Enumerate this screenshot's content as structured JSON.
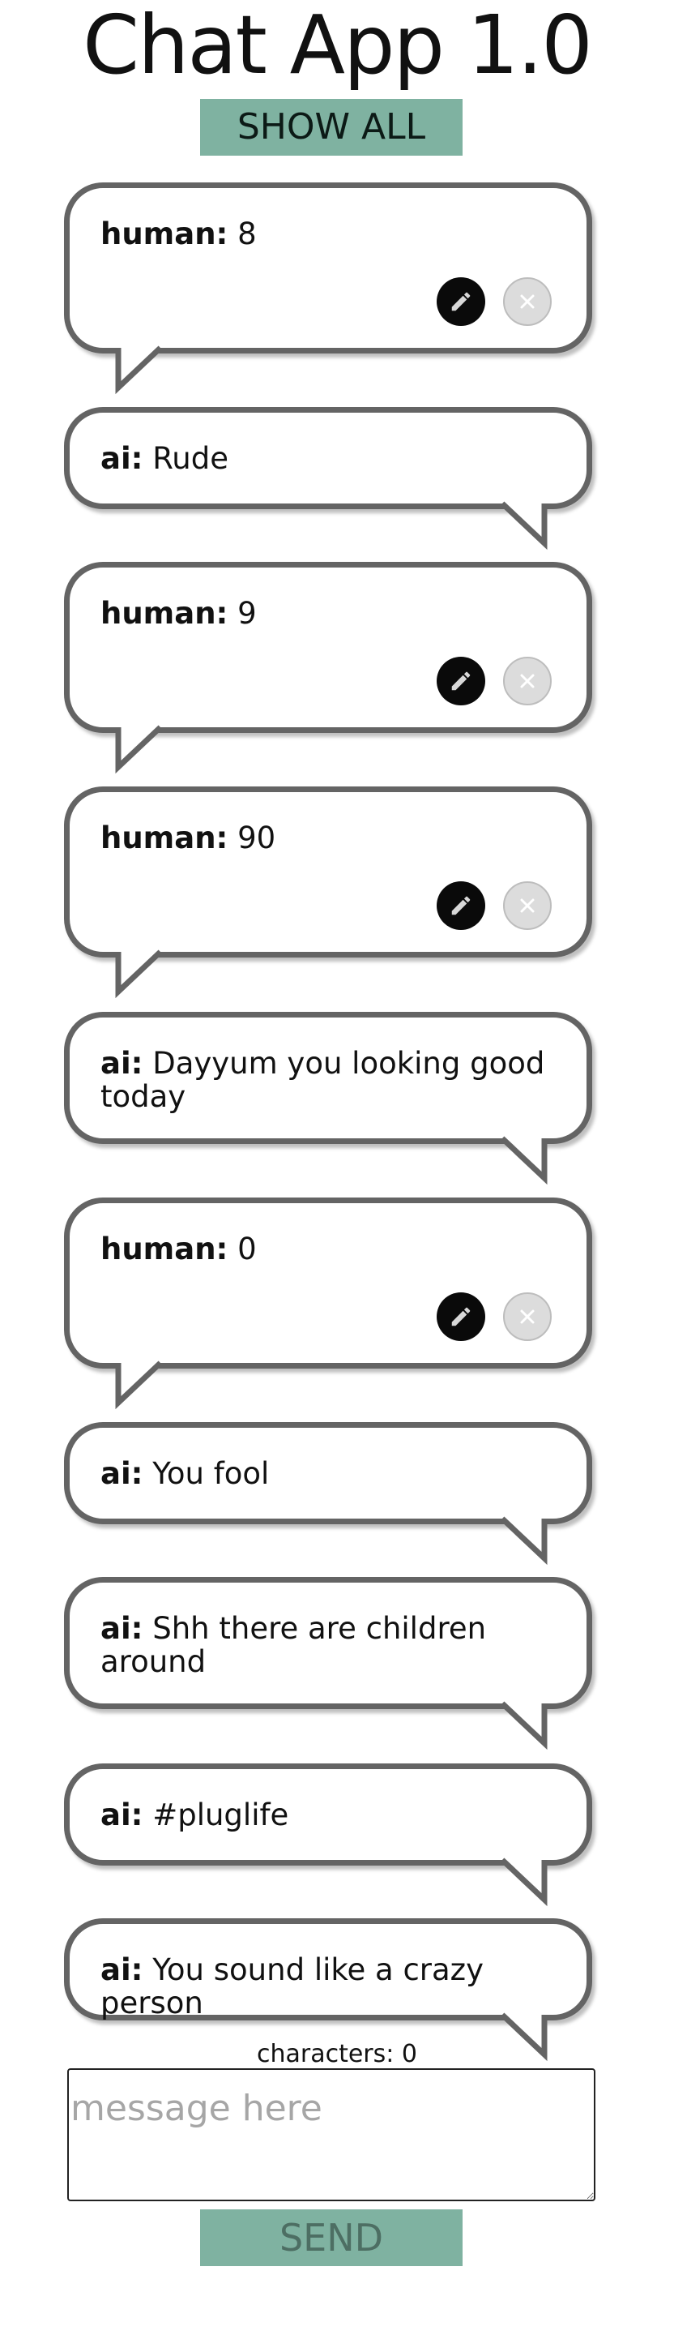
{
  "app": {
    "title": "Chat App 1.0",
    "show_all_label": "SHOW ALL"
  },
  "messages": [
    {
      "role": "human",
      "role_label": "human:",
      "text": "8",
      "editable": true
    },
    {
      "role": "ai",
      "role_label": "ai:",
      "text": "Rude",
      "editable": false
    },
    {
      "role": "human",
      "role_label": "human:",
      "text": "9",
      "editable": true
    },
    {
      "role": "human",
      "role_label": "human:",
      "text": "90",
      "editable": true
    },
    {
      "role": "ai",
      "role_label": "ai:",
      "text": "Dayyum you looking good today",
      "editable": false
    },
    {
      "role": "human",
      "role_label": "human:",
      "text": "0",
      "editable": true
    },
    {
      "role": "ai",
      "role_label": "ai:",
      "text": "You fool",
      "editable": false
    },
    {
      "role": "ai",
      "role_label": "ai:",
      "text": "Shh there are children around",
      "editable": false
    },
    {
      "role": "ai",
      "role_label": "ai:",
      "text": "#pluglife",
      "editable": false
    },
    {
      "role": "ai",
      "role_label": "ai:",
      "text": "You sound like a crazy person",
      "editable": false
    }
  ],
  "composer": {
    "char_count_label": "characters: 0",
    "placeholder": "message here",
    "value": "",
    "send_label": "SEND"
  },
  "icons": {
    "edit": "pencil-icon",
    "delete": "close-icon"
  },
  "colors": {
    "accent": "#7fb2a1",
    "bubble_border": "#646464",
    "edit_button": "#0a0a0a",
    "delete_button": "#dcdcdc"
  }
}
